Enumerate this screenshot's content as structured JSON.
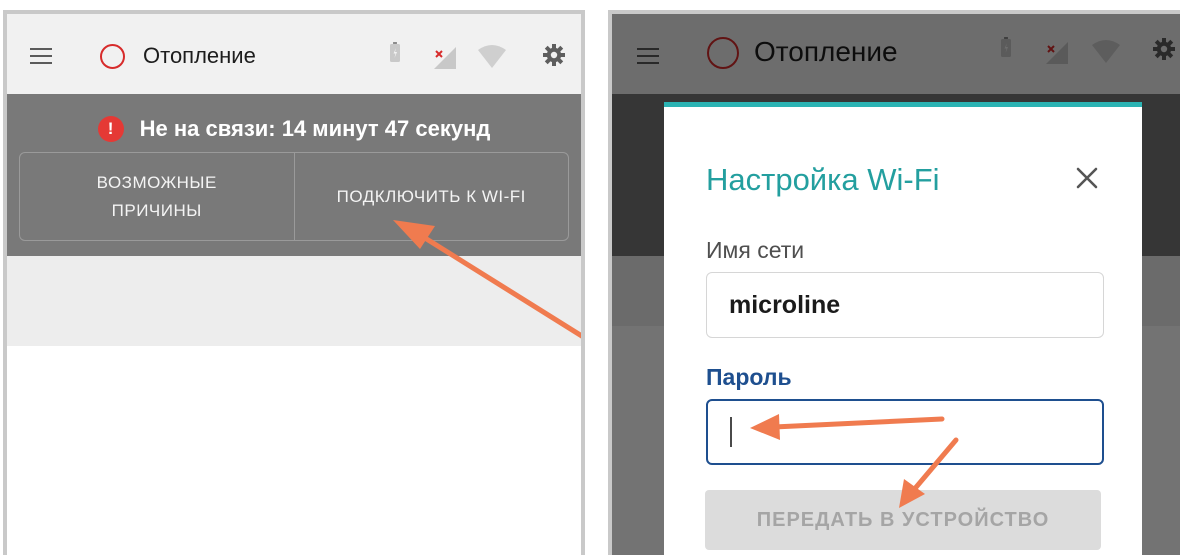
{
  "app": {
    "title": "Отопление"
  },
  "status": {
    "offline_text": "Не на связи: 14 минут 47 секунд"
  },
  "actions": {
    "possible_reasons_line1": "ВОЗМОЖНЫЕ",
    "possible_reasons_line2": "ПРИЧИНЫ",
    "connect_wifi": "ПОДКЛЮЧИТЬ К WI-FI"
  },
  "wifi_dialog": {
    "title": "Настройка Wi-Fi",
    "network_label": "Имя сети",
    "network_value": "microline",
    "password_label": "Пароль",
    "password_value": "",
    "submit_label": "ПЕРЕДАТЬ В УСТРОЙСТВО"
  },
  "colors": {
    "accent_teal": "#2bb3b3",
    "focus_blue": "#1e4f8f",
    "error_red": "#e53935",
    "status_red": "#d72b2b",
    "annotation_orange": "#f07b4f"
  },
  "icons": [
    "menu-icon",
    "status-ring-icon",
    "battery-icon",
    "no-cellular-signal-icon",
    "wifi-icon",
    "gear-icon",
    "error-icon",
    "close-icon"
  ]
}
